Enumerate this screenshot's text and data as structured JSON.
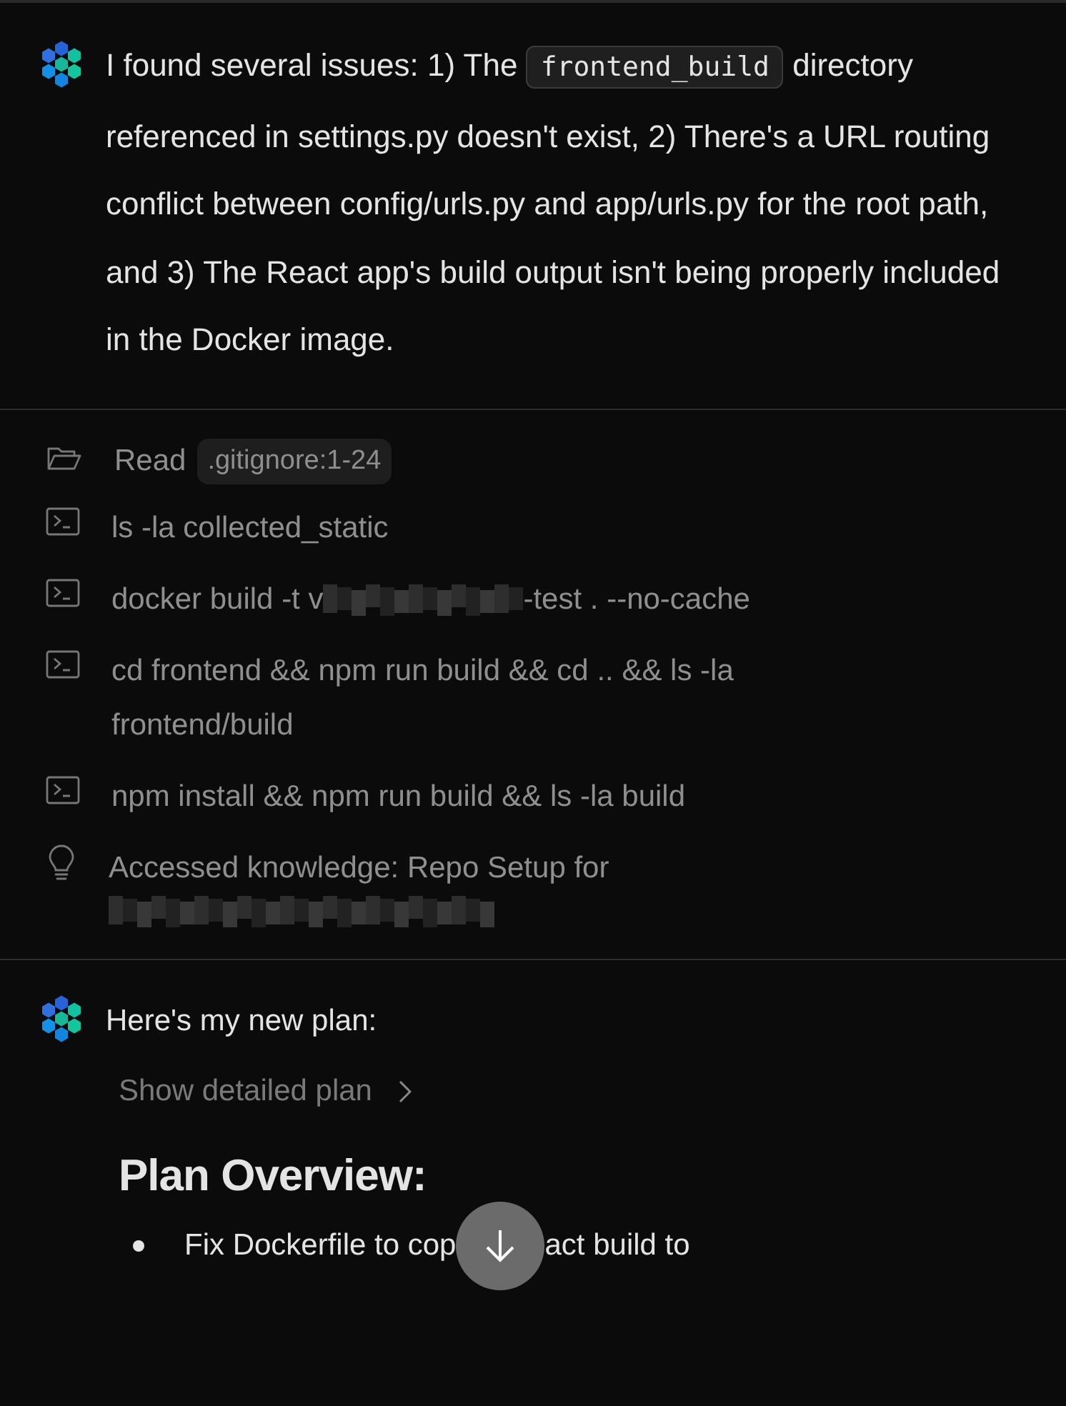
{
  "messages": [
    {
      "kind": "agent",
      "before_code": "I found several issues: 1) The",
      "code": "frontend_build",
      "after_code": "directory referenced in settings.py doesn't exist, 2) There's a URL routing conflict between config/urls.py and app/urls.py for the root path, and 3) The React app's build output isn't being properly included in the Docker image."
    }
  ],
  "actions": [
    {
      "kind": "read",
      "label": "Read",
      "chip": ".gitignore:1-24"
    },
    {
      "kind": "command",
      "text": "ls -la collected_static"
    },
    {
      "kind": "command",
      "text": "docker build -t v",
      "redacted": true,
      "after": "-test . --no-cache"
    },
    {
      "kind": "command",
      "text": "cd frontend && npm run build && cd .. && ls -la frontend/build"
    },
    {
      "kind": "command",
      "text": "npm install && npm run build && ls -la build"
    },
    {
      "kind": "knowledge",
      "text": "Accessed knowledge: Repo Setup for",
      "redacted": true
    }
  ],
  "plan": {
    "intro": "Here's my new plan:",
    "toggle": "Show detailed plan",
    "heading": "Plan Overview:",
    "bullets": [
      {
        "before": "Fix Dockerfile to cop",
        "after": "act build to"
      }
    ]
  }
}
